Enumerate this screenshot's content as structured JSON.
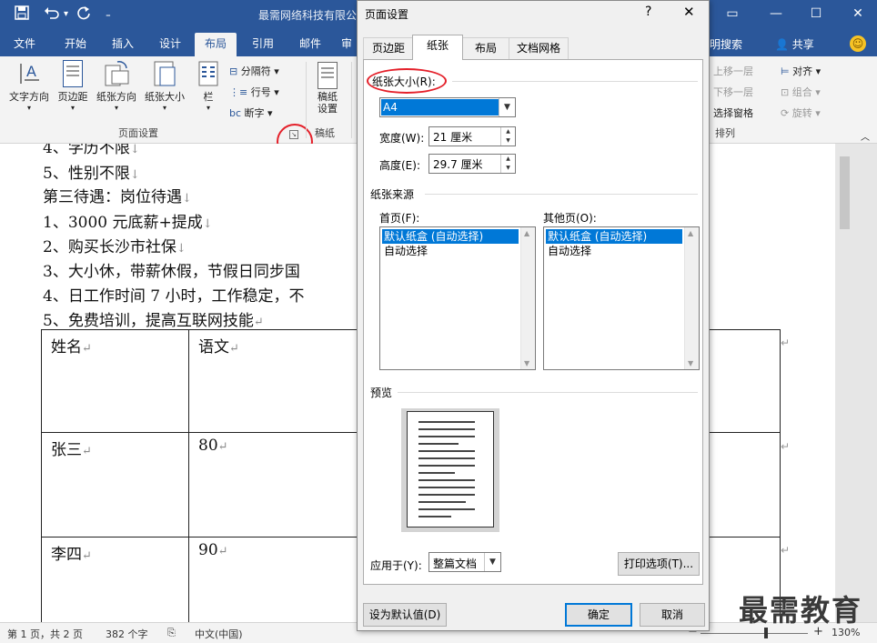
{
  "title_bar": {
    "doc_title": "最需网络科技有限公",
    "save_icon": "save-icon",
    "undo_icon": "undo-icon",
    "redo_icon": "redo-icon",
    "customize_icon": "customize-icon",
    "minimize": "—",
    "restore": "☐",
    "close": "✕",
    "ribbon_display": "▭"
  },
  "ribbon_tabs": [
    {
      "label": "文件"
    },
    {
      "label": "开始"
    },
    {
      "label": "插入"
    },
    {
      "label": "设计"
    },
    {
      "label": "布局"
    },
    {
      "label": "引用"
    },
    {
      "label": "邮件"
    },
    {
      "label": "审"
    }
  ],
  "ribbon_right": {
    "tell_me": "明搜索",
    "share": "共享",
    "smiley": "☺"
  },
  "ribbon": {
    "text_direction": "文字方向",
    "margins": "页边距",
    "orientation": "纸张方向",
    "size": "纸张大小",
    "columns": "栏",
    "breaks": "分隔符",
    "line_numbers": "行号",
    "hyphenation": "断字",
    "page_setup_group": "页面设置",
    "manuscript_setup": "稿纸\n设置",
    "manuscript_group": "稿纸",
    "bring_forward": "上移一层",
    "send_backward": "下移一层",
    "selection_pane": "选择窗格",
    "align": "对齐",
    "group": "组合",
    "rotate": "旋转",
    "arrange_group": "排列"
  },
  "document": {
    "lines": [
      "4、学历不限",
      "5、性别不限",
      "第三待遇：岗位待遇",
      "1、3000 元底薪+提成",
      "2、购买长沙市社保",
      "3、大小休，带薪休假，节假日同步国",
      "4、日工作时间 7 小时，工作稳定，不",
      "5、免费培训，提高互联网技能"
    ],
    "table": [
      [
        "姓名",
        "语文"
      ],
      [
        "张三",
        "80"
      ],
      [
        "李四",
        "90"
      ]
    ]
  },
  "status_bar": {
    "page": "第 1 页，共 2 页",
    "words": "382 个字",
    "language": "中文(中国)",
    "zoom": "130%",
    "zoom_minus": "−",
    "zoom_plus": "+"
  },
  "watermark": "最需教育",
  "dialog": {
    "title": "页面设置",
    "help": "?",
    "close": "✕",
    "tabs": [
      {
        "label": "页边距"
      },
      {
        "label": "纸张"
      },
      {
        "label": "布局"
      },
      {
        "label": "文档网格"
      }
    ],
    "paper_size_label": "纸张大小(R):",
    "paper_size_value": "A4",
    "width_label": "宽度(W):",
    "width_value": "21 厘米",
    "height_label": "高度(E):",
    "height_value": "29.7 厘米",
    "paper_source_label": "纸张来源",
    "first_page_label": "首页(F):",
    "other_pages_label": "其他页(O):",
    "first_page_options": [
      "默认纸盒 (自动选择)",
      "自动选择"
    ],
    "other_pages_options": [
      "默认纸盒 (自动选择)",
      "自动选择"
    ],
    "preview_label": "预览",
    "apply_to_label": "应用于(Y):",
    "apply_to_value": "整篇文档",
    "print_options": "打印选项(T)...",
    "set_default": "设为默认值(D)",
    "ok": "确定",
    "cancel": "取消"
  },
  "colors": {
    "accent": "#2b579a",
    "selection": "#0078d7",
    "annotation": "#e4202a"
  }
}
